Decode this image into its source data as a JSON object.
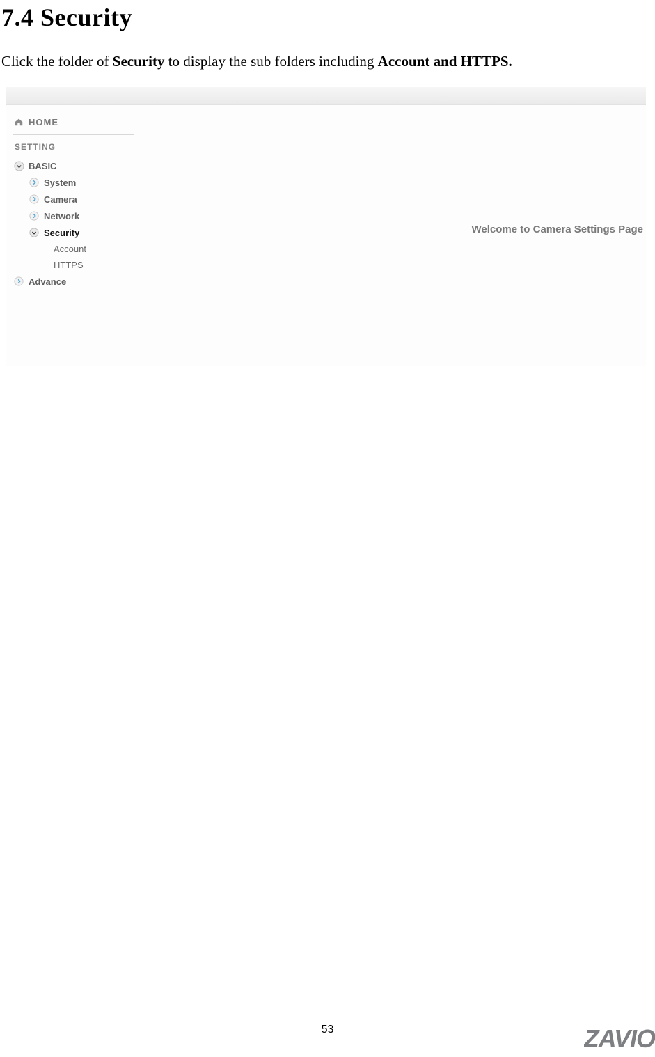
{
  "section_title": "7.4 Security",
  "intro": {
    "prefix": "Click the folder of ",
    "bold1": "Security",
    "middle": " to display the sub folders including ",
    "bold2": "Account and HTTPS."
  },
  "sidebar": {
    "home": "HOME",
    "setting": "SETTING",
    "basic": "BASIC",
    "items": {
      "system": "System",
      "camera": "Camera",
      "network": "Network",
      "security": "Security",
      "account": "Account",
      "https": "HTTPS"
    },
    "advance": "Advance"
  },
  "main": {
    "welcome": "Welcome to Camera Settings Page"
  },
  "page_number": "53",
  "logo_text": "ZAVIO"
}
